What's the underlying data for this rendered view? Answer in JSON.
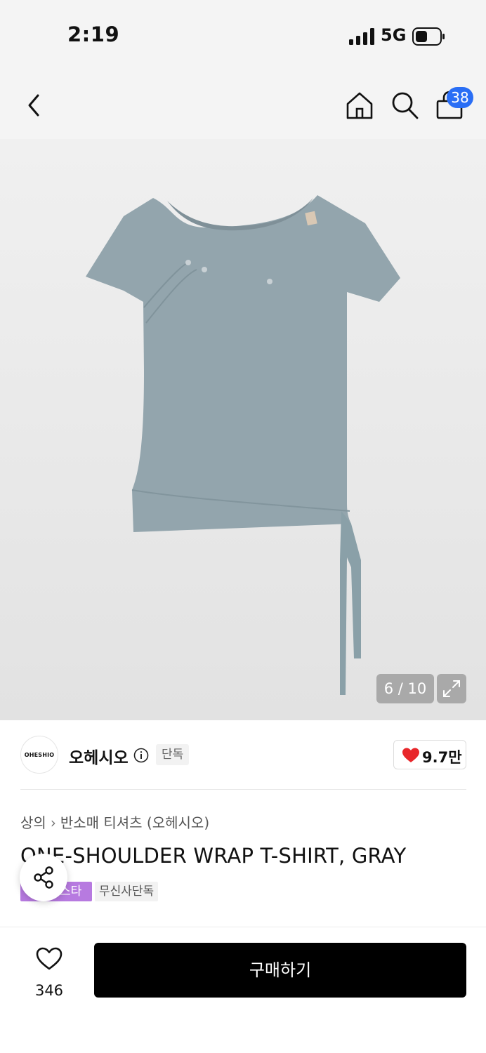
{
  "status_bar": {
    "time": "2:19",
    "network": "5G"
  },
  "nav": {
    "cart_count": "38"
  },
  "gallery": {
    "counter": "6 / 10"
  },
  "brand": {
    "logo_text": "OHESHIO",
    "name": "오헤시오",
    "exclusive_tag": "단독",
    "likes": "9.7만"
  },
  "product": {
    "breadcrumb": [
      "상의",
      "반소매 티셔츠 (오헤시오)"
    ],
    "title": "ONE-SHOULDER WRAP T-SHIRT, GRAY",
    "tags": [
      "스타",
      "무신사단독"
    ],
    "shirt_color": "#93a5ad"
  },
  "bottom_bar": {
    "wish_count": "346",
    "buy_label": "구매하기"
  },
  "colors": {
    "accent_blue": "#2a6ef5",
    "heart_red": "#e8262a",
    "tag_purple": "#b77ae0"
  }
}
